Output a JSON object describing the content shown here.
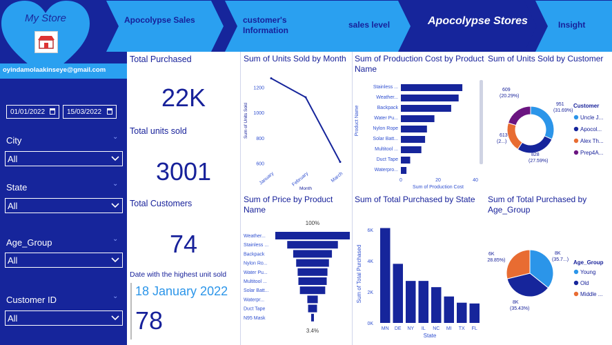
{
  "header": {
    "store_name": "My Store",
    "nav": [
      "Apocolypse Sales",
      "customer's Information",
      "sales level",
      "Apocolypse Stores",
      "Insight"
    ]
  },
  "sidebar": {
    "email": "oyindamolaakinseye@gmail.com",
    "date_start": "01/01/2022",
    "date_end": "15/03/2022",
    "slicers": [
      {
        "label": "City",
        "value": "All"
      },
      {
        "label": "State",
        "value": "All"
      },
      {
        "label": "Age_Group",
        "value": "All"
      },
      {
        "label": "Customer ID",
        "value": "All"
      }
    ]
  },
  "kpis": {
    "total_purchased_label": "Total Purchased",
    "total_purchased_value": "22K",
    "units_sold_label": "Total units sold",
    "units_sold_value": "3001",
    "customers_label": "Total Customers",
    "customers_value": "74",
    "top_date_label": "Date with the highest unit sold",
    "top_date_value": "18 January 2022",
    "top_date_units": "78"
  },
  "chart_data": [
    {
      "type": "line",
      "title": "Sum of Units Sold by Month",
      "xlabel": "Month",
      "ylabel": "Sum of Units Sold",
      "x": [
        "January",
        "February",
        "March"
      ],
      "y": [
        1270,
        1120,
        610
      ],
      "yticks": [
        600,
        800,
        1000,
        1200
      ],
      "ylim": [
        570,
        1300
      ]
    },
    {
      "type": "bar",
      "orientation": "horizontal",
      "title": "Sum of Production Cost by Product Name",
      "xlabel": "Sum of Production Cost",
      "ylabel": "Product Name",
      "categories": [
        "Stainless ...",
        "Weather...",
        "Backpack",
        "Water Pu...",
        "Nylon Rope",
        "Solar Batt...",
        "Multitool ...",
        "Duct Tape",
        "Waterpro..."
      ],
      "values": [
        33,
        31,
        27,
        18,
        14,
        13,
        11,
        5,
        3
      ],
      "xticks": [
        0,
        20,
        40
      ],
      "xlim": [
        0,
        40
      ]
    },
    {
      "type": "pie",
      "donut": true,
      "title": "Sum of Units Sold by Customer",
      "legend_title": "Customer",
      "legend": [
        "Uncle J...",
        "Apocol...",
        "Alex Th...",
        "Prep4A..."
      ],
      "values": [
        951,
        828,
        613,
        609
      ],
      "data_labels": [
        "951 (31.69%)",
        "828 (27.59%)",
        "613 (2...)",
        "609 (20.29%)"
      ],
      "colors": [
        "#2b95e9",
        "#16259b",
        "#e86c32",
        "#6b1581"
      ]
    },
    {
      "type": "bar",
      "orientation": "funnel",
      "title": "Sum of Price by Product Name",
      "categories": [
        "Weather...",
        "Stainless ...",
        "Backpack",
        "Nylon Ro...",
        "Water Pu...",
        "Multitool ...",
        "Solar Batt...",
        "Waterpr...",
        "Duct Tape",
        "N95 Mask"
      ],
      "values": [
        100,
        68,
        52,
        44,
        40,
        38,
        34,
        14,
        12,
        3.4
      ],
      "top_label": "100%",
      "bottom_label": "3.4%"
    },
    {
      "type": "bar",
      "title": "Sum of Total Purchased by State",
      "xlabel": "State",
      "ylabel": "Sum of Total Purchased",
      "categories": [
        "MN",
        "DE",
        "NY",
        "IL",
        "NC",
        "MI",
        "TX",
        "FL"
      ],
      "values": [
        6100,
        3800,
        2700,
        2700,
        2300,
        1700,
        1300,
        1250
      ],
      "yticks": [
        "0K",
        "2K",
        "4K",
        "6K"
      ],
      "ylim": [
        0,
        6300
      ]
    },
    {
      "type": "pie",
      "title": "Sum of Total Purchased by Age_Group",
      "legend_title": "Age_Group",
      "legend": [
        "Young",
        "Old",
        "Middle ..."
      ],
      "values": [
        35.7,
        35.43,
        28.85
      ],
      "data_labels": [
        "8K (35.7...)",
        "8K (35.43%)",
        "6K (28.85%)"
      ],
      "colors": [
        "#2b95e9",
        "#16259b",
        "#e86c32"
      ]
    }
  ]
}
